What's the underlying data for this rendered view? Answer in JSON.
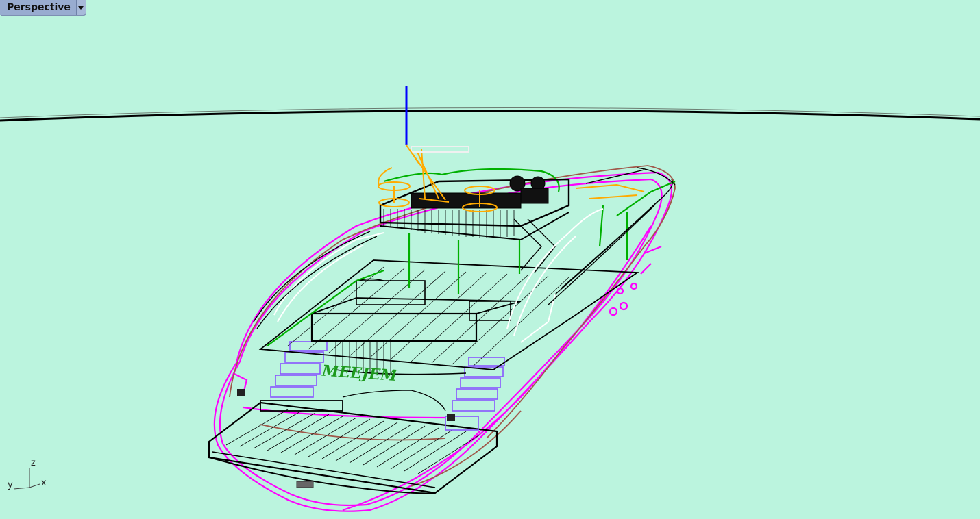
{
  "viewport": {
    "name": "Perspective",
    "background": "#bbf4de"
  },
  "axes": {
    "x": "x",
    "y": "y",
    "z": "z"
  },
  "model": {
    "name_text": "MEEJEM",
    "layer_colors": {
      "hull": "#ff00ff",
      "deck": "#000000",
      "trim": "#a0584a",
      "structure": "#00b000",
      "stairs": "#8855ff",
      "furniture": "#ffaa00",
      "glazing": "#ffffff",
      "mast": "#0000ff"
    }
  }
}
